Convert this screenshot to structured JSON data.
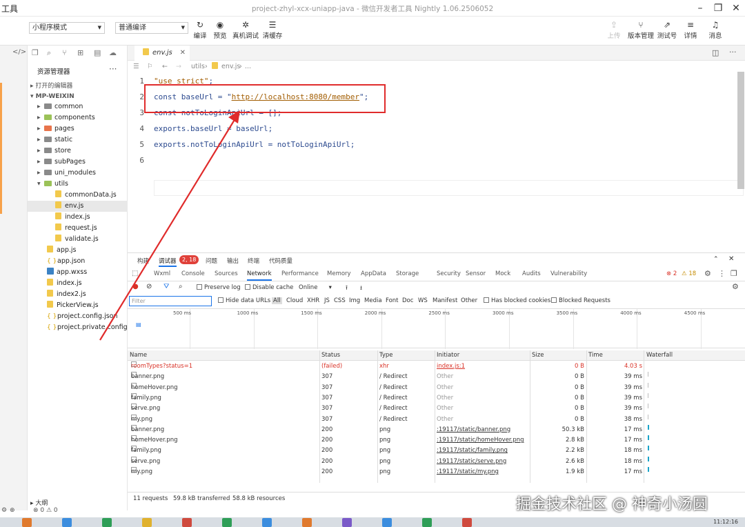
{
  "titlebar": {
    "app_name": "工具",
    "window_title": "project-zhyl-xcx-uniapp-java - 微信开发者工具 Nightly 1.06.2506052"
  },
  "toolbar": {
    "mode_select": "小程序模式",
    "compile_select": "普通编译",
    "buttons": [
      {
        "label": "编译",
        "icon": "refresh-icon"
      },
      {
        "label": "预览",
        "icon": "eye-icon"
      },
      {
        "label": "真机调试",
        "icon": "bug-icon"
      },
      {
        "label": "清缓存",
        "icon": "layers-icon"
      }
    ],
    "right_buttons": [
      {
        "label": "上传",
        "icon": "upload-icon",
        "disabled": true
      },
      {
        "label": "版本管理",
        "icon": "branch-icon"
      },
      {
        "label": "测试号",
        "icon": "external-icon"
      },
      {
        "label": "详情",
        "icon": "menu-icon"
      },
      {
        "label": "消息",
        "icon": "bell-icon"
      }
    ]
  },
  "sidebar": {
    "title": "资源管理器",
    "open_editors": "打开的编辑器",
    "project": "MP-WEIXIN",
    "outline": "大纲",
    "tree": [
      {
        "label": "common",
        "type": "folder",
        "depth": 1,
        "expanded": false
      },
      {
        "label": "components",
        "type": "folder-green",
        "depth": 1,
        "expanded": false
      },
      {
        "label": "pages",
        "type": "folder-orange",
        "depth": 1,
        "expanded": false
      },
      {
        "label": "static",
        "type": "folder",
        "depth": 1,
        "expanded": false
      },
      {
        "label": "store",
        "type": "folder",
        "depth": 1,
        "expanded": false
      },
      {
        "label": "subPages",
        "type": "folder",
        "depth": 1,
        "expanded": false
      },
      {
        "label": "uni_modules",
        "type": "folder",
        "depth": 1,
        "expanded": false
      },
      {
        "label": "utils",
        "type": "folder-green",
        "depth": 1,
        "expanded": true
      },
      {
        "label": "commonData.js",
        "type": "js",
        "depth": 2
      },
      {
        "label": "env.js",
        "type": "js",
        "depth": 2,
        "selected": true
      },
      {
        "label": "index.js",
        "type": "js",
        "depth": 2
      },
      {
        "label": "request.js",
        "type": "js",
        "depth": 2
      },
      {
        "label": "validate.js",
        "type": "js",
        "depth": 2
      },
      {
        "label": "app.js",
        "type": "js",
        "depth": 1
      },
      {
        "label": "app.json",
        "type": "json",
        "depth": 1
      },
      {
        "label": "app.wxss",
        "type": "wxss",
        "depth": 1
      },
      {
        "label": "index.js",
        "type": "js",
        "depth": 1
      },
      {
        "label": "index2.js",
        "type": "js",
        "depth": 1
      },
      {
        "label": "PickerView.js",
        "type": "js",
        "depth": 1
      },
      {
        "label": "project.config.json",
        "type": "json",
        "depth": 1
      },
      {
        "label": "project.private.config.js...",
        "type": "json",
        "depth": 1
      }
    ]
  },
  "editor": {
    "tab_label": "env.js",
    "breadcrumb": [
      "utils",
      "env.js",
      "..."
    ],
    "lines": [
      {
        "num": "1",
        "parts": [
          {
            "t": "\"use strict\"",
            "c": "str"
          },
          {
            "t": ";",
            "c": ""
          }
        ]
      },
      {
        "num": "2",
        "parts": [
          {
            "t": "const baseUrl = \"",
            "c": ""
          },
          {
            "t": "http://localhost:8080/member",
            "c": "url"
          },
          {
            "t": "\";",
            "c": ""
          }
        ]
      },
      {
        "num": "3",
        "parts": [
          {
            "t": "const notToLoginApiUrl = [];",
            "c": ""
          }
        ]
      },
      {
        "num": "4",
        "parts": [
          {
            "t": "exports.baseUrl = baseUrl;",
            "c": ""
          }
        ]
      },
      {
        "num": "5",
        "parts": [
          {
            "t": "exports.notToLoginApiUrl = notToLoginApiUrl;",
            "c": ""
          }
        ]
      },
      {
        "num": "6",
        "parts": []
      }
    ]
  },
  "devtools": {
    "top_tabs": [
      "构建",
      "调试器",
      "问题",
      "输出",
      "终端",
      "代码质量"
    ],
    "active_top": "调试器",
    "badge": "2, 18",
    "sub_tabs": [
      "Wxml",
      "Console",
      "Sources",
      "Network",
      "Performance",
      "Memory",
      "AppData",
      "Storage",
      "Security",
      "Sensor",
      "Mock",
      "Audits",
      "Vulnerability"
    ],
    "active_sub": "Network",
    "errors": "2",
    "warnings": "18",
    "preserve_log": "Preserve log",
    "disable_cache": "Disable cache",
    "throttle": "Online",
    "filter_placeholder": "Filter",
    "hide_data_urls": "Hide data URLs",
    "filter_types": [
      "All",
      "Cloud",
      "XHR",
      "JS",
      "CSS",
      "Img",
      "Media",
      "Font",
      "Doc",
      "WS",
      "Manifest",
      "Other"
    ],
    "has_blocked": "Has blocked cookies",
    "blocked_requests": "Blocked Requests",
    "timeline_ticks": [
      "500 ms",
      "1000 ms",
      "1500 ms",
      "2000 ms",
      "2500 ms",
      "3000 ms",
      "3500 ms",
      "4000 ms",
      "4500 ms"
    ],
    "columns": [
      "Name",
      "Status",
      "Type",
      "Initiator",
      "Size",
      "Time",
      "Waterfall"
    ],
    "rows": [
      {
        "name": "roomTypes?status=1",
        "status": "(failed)",
        "type": "xhr",
        "initiator": "index.js:1",
        "size": "0 B",
        "time": "4.03 s",
        "error": true
      },
      {
        "name": "banner.png",
        "status": "307",
        "type": "/ Redirect",
        "initiator": "Other",
        "size": "0 B",
        "time": "39 ms"
      },
      {
        "name": "homeHover.png",
        "status": "307",
        "type": "/ Redirect",
        "initiator": "Other",
        "size": "0 B",
        "time": "39 ms"
      },
      {
        "name": "family.png",
        "status": "307",
        "type": "/ Redirect",
        "initiator": "Other",
        "size": "0 B",
        "time": "39 ms"
      },
      {
        "name": "serve.png",
        "status": "307",
        "type": "/ Redirect",
        "initiator": "Other",
        "size": "0 B",
        "time": "39 ms"
      },
      {
        "name": "my.png",
        "status": "307",
        "type": "/ Redirect",
        "initiator": "Other",
        "size": "0 B",
        "time": "38 ms"
      },
      {
        "name": "banner.png",
        "status": "200",
        "type": "png",
        "initiator": ":19117/static/banner.png",
        "size": "50.3 kB",
        "time": "17 ms"
      },
      {
        "name": "homeHover.png",
        "status": "200",
        "type": "png",
        "initiator": ":19117/static/homeHover.png",
        "size": "2.8 kB",
        "time": "17 ms"
      },
      {
        "name": "family.png",
        "status": "200",
        "type": "png",
        "initiator": ":19117/static/family.png",
        "size": "2.2 kB",
        "time": "18 ms"
      },
      {
        "name": "serve.png",
        "status": "200",
        "type": "png",
        "initiator": ":19117/static/serve.png",
        "size": "2.6 kB",
        "time": "18 ms"
      },
      {
        "name": "my.png",
        "status": "200",
        "type": "png",
        "initiator": ":19117/static/my.png",
        "size": "1.9 kB",
        "time": "17 ms"
      }
    ],
    "summary": [
      "11 requests",
      "59.8 kB transferred",
      "58.8 kB resources"
    ]
  },
  "statusbar": {
    "problems": "⊗ 0 ⚠ 0"
  },
  "watermark": "掘金技术社区 @ 神奇小汤圆",
  "clock": "11:12:16",
  "colors": {
    "annotation_red": "#e02b2b",
    "accent_blue": "#1a73e8",
    "error_red": "#d93025"
  }
}
